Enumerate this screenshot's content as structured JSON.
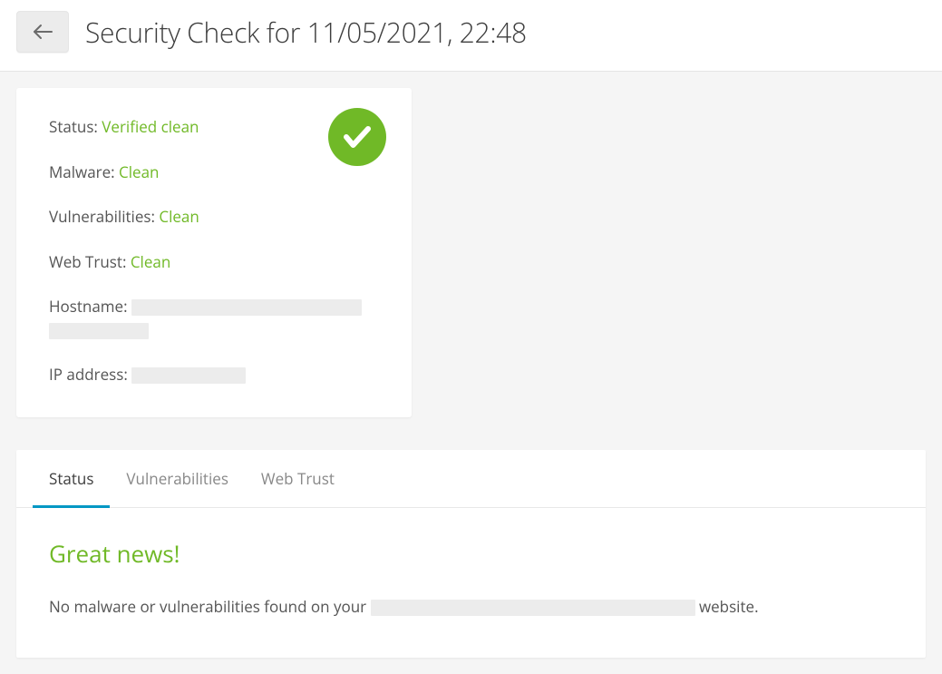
{
  "header": {
    "title": "Security Check for 11/05/2021, 22:48"
  },
  "card": {
    "status_label": "Status: ",
    "status_value": "Verified clean",
    "malware_label": "Malware: ",
    "malware_value": "Clean",
    "vuln_label": "Vulnerabilities: ",
    "vuln_value": "Clean",
    "webtrust_label": "Web Trust: ",
    "webtrust_value": "Clean",
    "hostname_label": "Hostname: ",
    "ip_label": "IP address: "
  },
  "tabs": {
    "status": "Status",
    "vulnerabilities": "Vulnerabilities",
    "webtrust": "Web Trust"
  },
  "panel": {
    "heading": "Great news!",
    "text_before": "No malware or vulnerabilities found on your ",
    "text_after": " website."
  },
  "colors": {
    "accent_green": "#70b927",
    "accent_blue": "#0097c4"
  }
}
